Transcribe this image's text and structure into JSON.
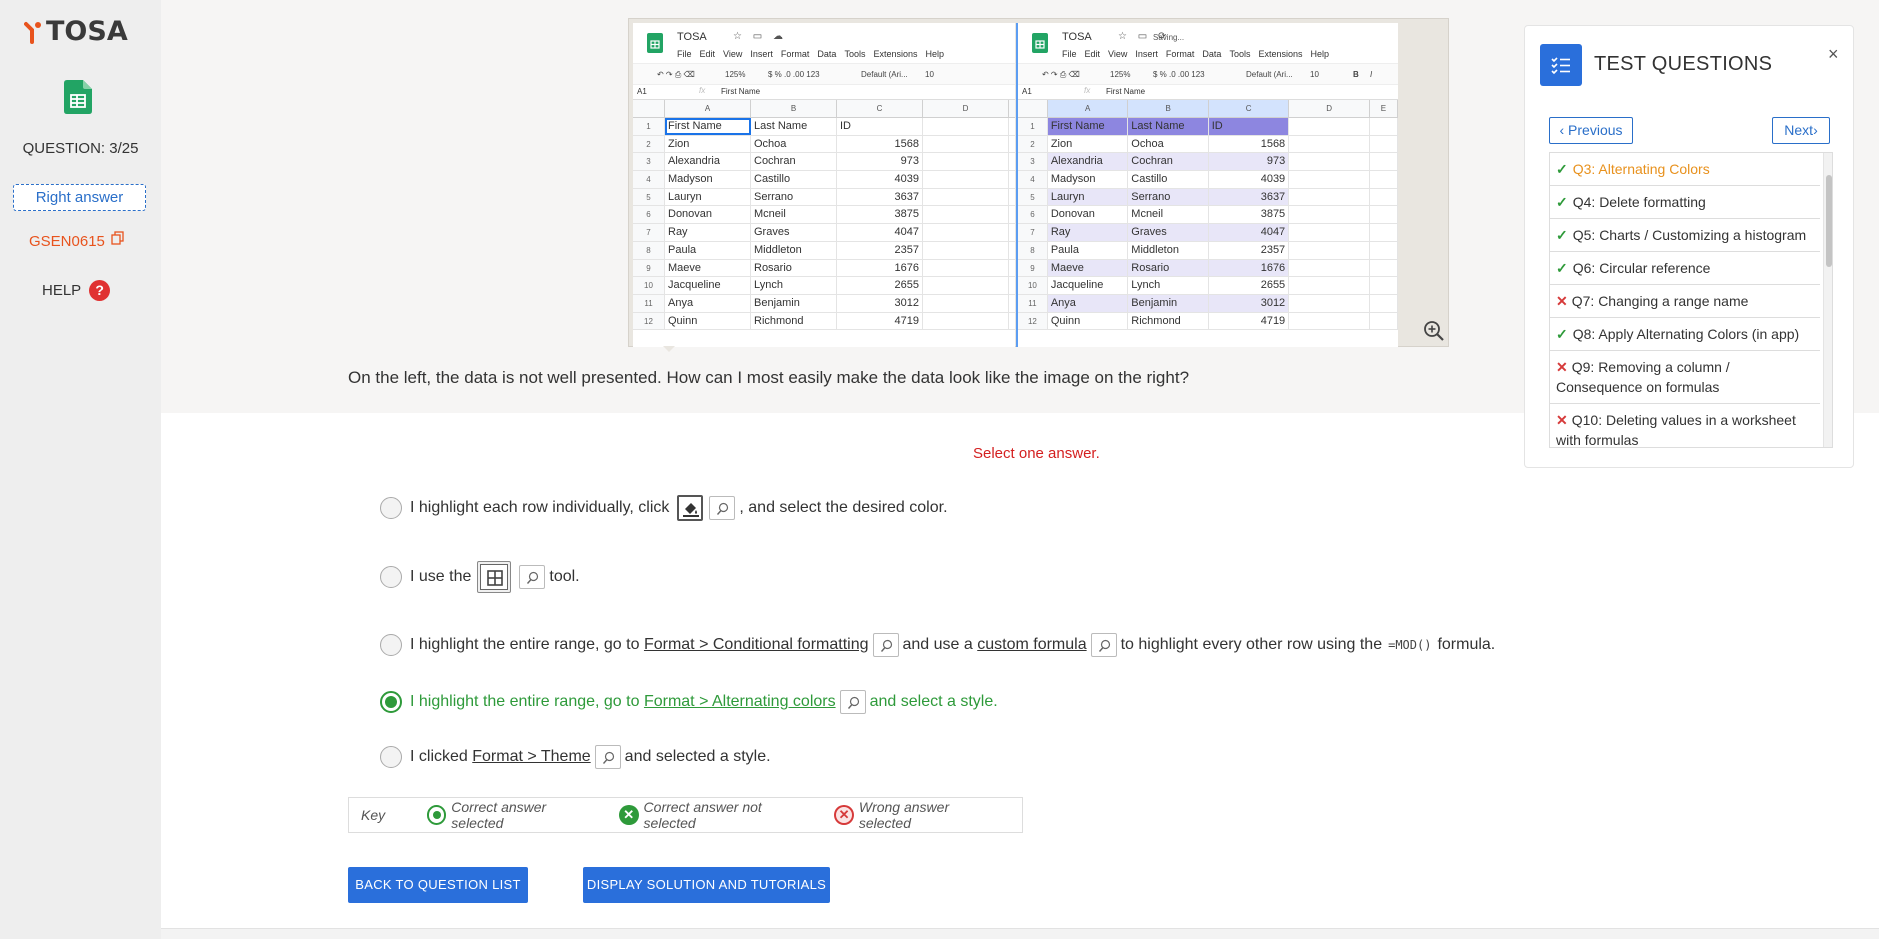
{
  "brand": {
    "name": "TOSA",
    "accent": "#e8531d"
  },
  "sidebar": {
    "question_label": "QUESTION: 3/25",
    "right_answer": "Right answer",
    "code": "GSEN0615",
    "help": "HELP",
    "help_icon": "?"
  },
  "spreadsheet": {
    "doc_title": "TOSA",
    "saving": "Saving...",
    "menu": [
      "File",
      "Edit",
      "View",
      "Insert",
      "Format",
      "Data",
      "Tools",
      "Extensions",
      "Help"
    ],
    "zoom": "125%",
    "font": "Default (Ari...",
    "font_size": "10",
    "cell_ref": "A1",
    "formula_value": "First Name",
    "columns": [
      "A",
      "B",
      "C",
      "D"
    ],
    "columns_right": [
      "A",
      "B",
      "C",
      "D",
      "E"
    ],
    "rows": [
      [
        "First Name",
        "Last Name",
        "ID"
      ],
      [
        "Zion",
        "Ochoa",
        "1568"
      ],
      [
        "Alexandria",
        "Cochran",
        "973"
      ],
      [
        "Madyson",
        "Castillo",
        "4039"
      ],
      [
        "Lauryn",
        "Serrano",
        "3637"
      ],
      [
        "Donovan",
        "Mcneil",
        "3875"
      ],
      [
        "Ray",
        "Graves",
        "4047"
      ],
      [
        "Paula",
        "Middleton",
        "2357"
      ],
      [
        "Maeve",
        "Rosario",
        "1676"
      ],
      [
        "Jacqueline",
        "Lynch",
        "2655"
      ],
      [
        "Anya",
        "Benjamin",
        "3012"
      ],
      [
        "Quinn",
        "Richmond",
        "4719"
      ]
    ]
  },
  "question_text": "On the left, the data is not well presented. How can I most easily make the data look like the image on the right?",
  "panel": {
    "title": "TEST QUESTIONS",
    "close": "×",
    "prev": "Previous",
    "next": "Next",
    "items": [
      {
        "label": "Q3: Alternating Colors",
        "status": "ok",
        "active": true
      },
      {
        "label": "Q4: Delete formatting",
        "status": "ok"
      },
      {
        "label": "Q5: Charts / Customizing a histogram",
        "status": "ok"
      },
      {
        "label": "Q6: Circular reference",
        "status": "ok"
      },
      {
        "label": "Q7: Changing a range name",
        "status": "bad"
      },
      {
        "label": "Q8: Apply Alternating Colors (in app)",
        "status": "ok"
      },
      {
        "label": "Q9: Removing a column / Consequence on formulas",
        "status": "bad"
      },
      {
        "label": "Q10: Deleting values in a worksheet with formulas",
        "status": "bad"
      }
    ]
  },
  "select_one": "Select one answer.",
  "answers": {
    "a1": {
      "pre": "I highlight each row individually, click",
      "post": ", and select the desired color."
    },
    "a2": {
      "pre": "I use the",
      "post": "tool."
    },
    "a3": {
      "pre": "I highlight the entire range, go to",
      "link1": "Format > Conditional formatting",
      "mid": "and use a",
      "link2": "custom formula",
      "mid2": "to highlight every other row using the",
      "code": "=MOD()",
      "post": "formula."
    },
    "a4": {
      "pre": "I highlight the entire range, go to",
      "link": "Format > Alternating colors",
      "post": "and select a style."
    },
    "a5": {
      "pre": "I clicked",
      "link": "Format > Theme",
      "post": "and selected a style."
    }
  },
  "key": {
    "label": "Key",
    "selected_correct": "Correct answer selected",
    "correct_not_selected": "Correct answer not selected",
    "wrong_selected": "Wrong answer selected"
  },
  "buttons": {
    "back": "BACK TO QUESTION LIST",
    "solution": "DISPLAY SOLUTION AND TUTORIALS"
  },
  "colors": {
    "primary": "#2a6fdb",
    "correct": "#2e9a3a",
    "wrong": "#d63a3a",
    "active": "#e8911d"
  }
}
